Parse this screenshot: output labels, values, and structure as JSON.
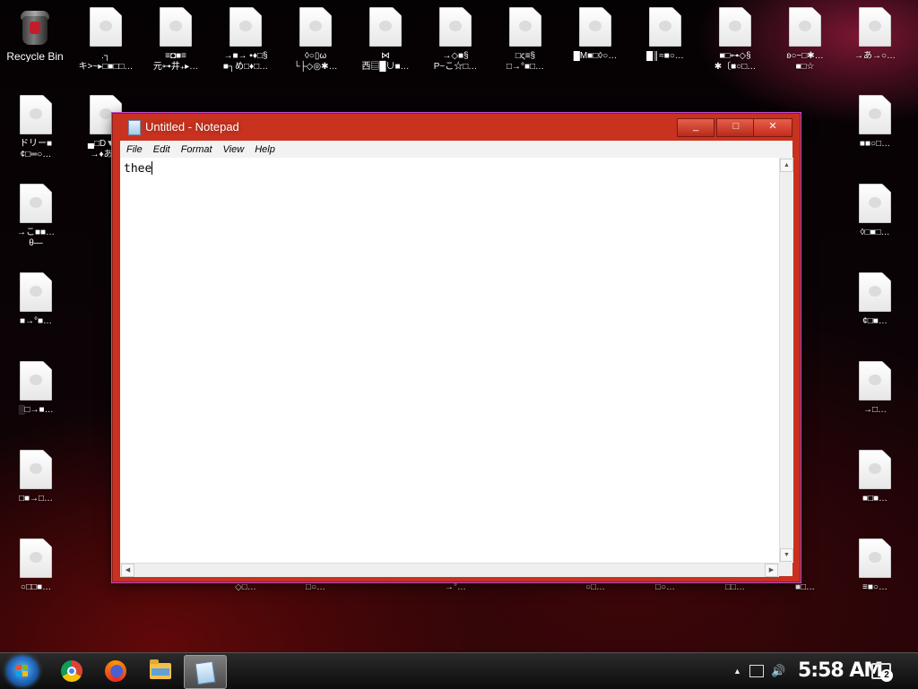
{
  "desktop": {
    "recycle_bin": "Recycle Bin",
    "icons": [
      {
        "label": ".┐\nキ>~▸□■□□…"
      },
      {
        "label": "≡◘■≡\n元⊶井₊▸…"
      },
      {
        "label": "→■→ ▪♦□§\n■┐め□♦□…"
      },
      {
        "label": "◊○▯ω\n└├◇◎✱…"
      },
      {
        "label": "⋈\n西▤█∪■…"
      },
      {
        "label": "→◇■§\nP~こ☆□…"
      },
      {
        "label": "□ς≡§\n□→°■□…"
      },
      {
        "label": "█M■□◊○…"
      },
      {
        "label": "█║≈■○…"
      },
      {
        "label": "■□⊶◇§\n✱〔■○□…"
      },
      {
        "label": "ʚ○−□✱…\n■□☆"
      },
      {
        "label": "→あ→○…"
      },
      {
        "label": "ドリー■\n¢□═○…"
      },
      {
        "label": "▄□D▼…\n→♦あ…"
      },
      {
        "label": "→こ■■…\nθ—"
      },
      {
        "label": "■→°■…"
      },
      {
        "label": "░□→■…"
      },
      {
        "label": "□■→□…"
      },
      {
        "label": "○□□■…"
      },
      {
        "label": "■■○□…"
      },
      {
        "label": "◊□■□…"
      },
      {
        "label": "¢□■…"
      },
      {
        "label": "→□…"
      },
      {
        "label": "■□■…"
      },
      {
        "label": "≡■○…"
      },
      {
        "label": "◇□…"
      },
      {
        "label": "□○…"
      },
      {
        "label": "→°…"
      },
      {
        "label": "○□…"
      },
      {
        "label": "□□…"
      },
      {
        "label": "■□…"
      },
      {
        "label": "□○…"
      }
    ]
  },
  "notepad": {
    "title": "Untitled - Notepad",
    "menu": [
      "File",
      "Edit",
      "Format",
      "View",
      "Help"
    ],
    "content": "thee",
    "min_label": "_",
    "max_label": "□",
    "close_label": "✕"
  },
  "taskbar": {
    "apps": [
      "chrome-icon",
      "firefox-icon",
      "file-explorer-icon",
      "notepad-icon"
    ],
    "clock": "5:58 AM",
    "notifications": "2"
  }
}
